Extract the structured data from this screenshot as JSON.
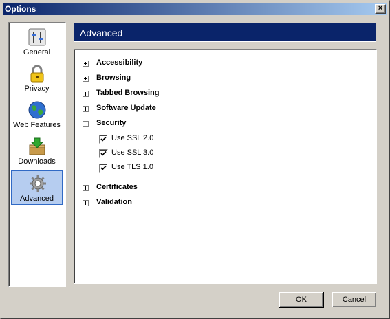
{
  "window": {
    "title": "Options",
    "close_label": "×"
  },
  "sidebar": {
    "items": [
      {
        "label": "General",
        "icon": "general-settings-icon"
      },
      {
        "label": "Privacy",
        "icon": "padlock-icon"
      },
      {
        "label": "Web Features",
        "icon": "globe-icon"
      },
      {
        "label": "Downloads",
        "icon": "download-box-icon"
      },
      {
        "label": "Advanced",
        "icon": "gear-icon",
        "selected": true
      }
    ]
  },
  "header": {
    "title": "Advanced"
  },
  "tree": {
    "accessibility": "Accessibility",
    "browsing": "Browsing",
    "tabbed_browsing": "Tabbed Browsing",
    "software_update": "Software Update",
    "security": "Security",
    "security_options": [
      {
        "label": "Use SSL 2.0",
        "checked": true
      },
      {
        "label": "Use SSL 3.0",
        "checked": true
      },
      {
        "label": "Use TLS 1.0",
        "checked": true
      }
    ],
    "certificates": "Certificates",
    "validation": "Validation"
  },
  "buttons": {
    "ok": "OK",
    "cancel": "Cancel"
  },
  "colors": {
    "title_bar": "#0a246a",
    "header_bg": "#0a246a",
    "selection": "#b6cdf0",
    "dialog_bg": "#d4d0c8"
  }
}
